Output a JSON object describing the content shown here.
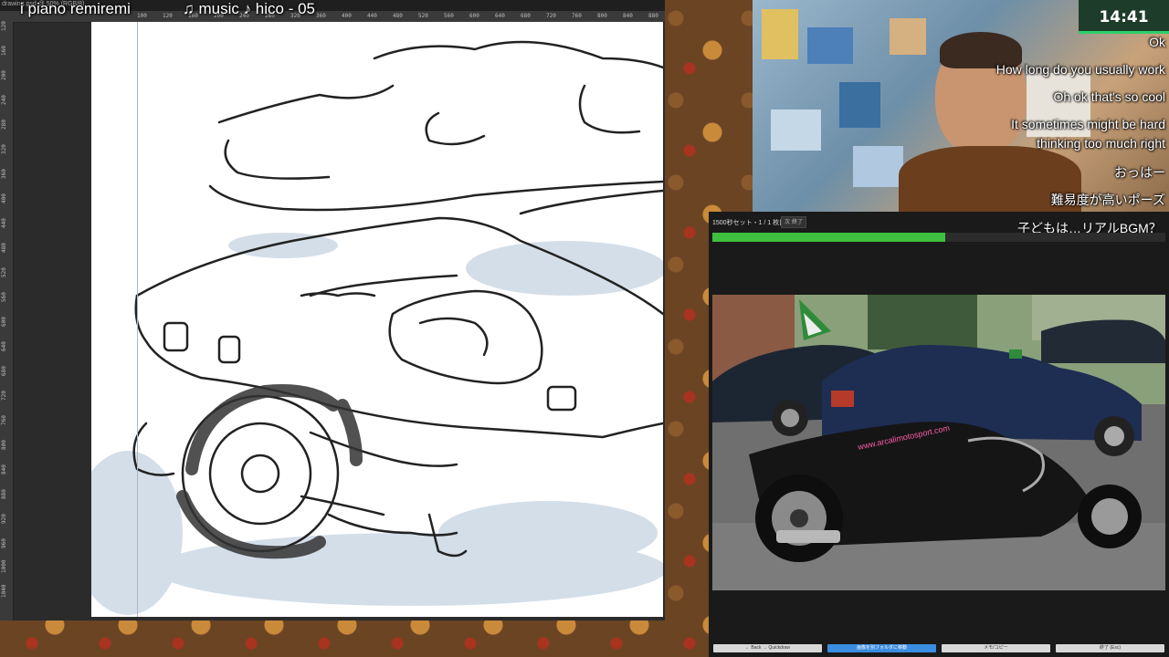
{
  "overlay": {
    "left_text": "i piano remiremi",
    "music_text": "♫ music ♪ hico - 05"
  },
  "drawing_app": {
    "doc_tab": "drawing.psd @ 50% (RGB/8)",
    "ruler_top": [
      "100",
      "120",
      "160",
      "200",
      "240",
      "280",
      "320",
      "360",
      "400",
      "440",
      "480",
      "520",
      "560",
      "600",
      "640",
      "680",
      "720",
      "760",
      "800",
      "840",
      "880"
    ],
    "ruler_left": [
      "120",
      "160",
      "200",
      "240",
      "280",
      "320",
      "360",
      "400",
      "440",
      "480",
      "520",
      "560",
      "600",
      "640",
      "680",
      "720",
      "760",
      "800",
      "840",
      "880",
      "920",
      "960",
      "1000",
      "1040"
    ]
  },
  "webcam": {
    "timer": "14:41",
    "timer_progress": 1.0,
    "chat": [
      "Ok",
      "How long do you usually work",
      "Oh ok that's so cool",
      "It sometimes might be hard",
      "thinking too much right",
      "おっはー",
      "難易度が高いポーズ"
    ]
  },
  "reference_panel": {
    "title": "1500秒セット・1 / 1 枚目",
    "pause_button": "次 終了",
    "bgm_label": "子どもは…リアルBGM？",
    "progress": 0.515,
    "photo_text": "www.arcalimotosport.com",
    "buttons": [
      "← Back → Quickdraw",
      "画像を別フォルダに移動",
      "メモ/コピー",
      "終了 (Esc)"
    ]
  },
  "colors": {
    "progress": "#3fbf3f",
    "primary_button": "#3a8de0",
    "timer_bg": "#1d3d2a"
  }
}
